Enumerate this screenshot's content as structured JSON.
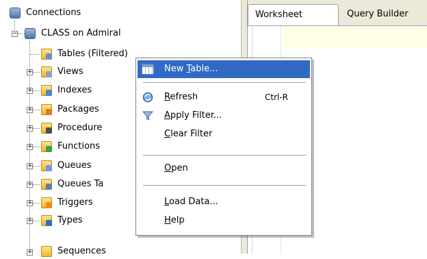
{
  "tree": {
    "root": {
      "label": "Connections",
      "icon": "connections-icon"
    },
    "connection": {
      "label": "CLASS on Admiral",
      "icon": "database-connection-icon"
    },
    "items": [
      {
        "label": "Tables (Filtered)",
        "icon": "tables-folder-icon"
      },
      {
        "label": "Views",
        "icon": "views-folder-icon"
      },
      {
        "label": "Indexes",
        "icon": "indexes-folder-icon"
      },
      {
        "label": "Packages",
        "icon": "packages-folder-icon"
      },
      {
        "label": "Procedure",
        "icon": "procedures-folder-icon"
      },
      {
        "label": "Functions",
        "icon": "functions-folder-icon"
      },
      {
        "label": "Queues",
        "icon": "queues-folder-icon"
      },
      {
        "label": "Queues Ta",
        "icon": "queue-tables-folder-icon"
      },
      {
        "label": "Triggers",
        "icon": "triggers-folder-icon"
      },
      {
        "label": "Types",
        "icon": "types-folder-icon"
      },
      {
        "label": "Sequences",
        "icon": "sequences-folder-icon"
      }
    ]
  },
  "tabs": [
    {
      "label": "Worksheet"
    },
    {
      "label": "Query Builder"
    }
  ],
  "context_menu": {
    "items": [
      {
        "pre": "New ",
        "key": "T",
        "post": "able...",
        "shortcut": "",
        "icon": "new-table-icon"
      },
      {
        "pre": "",
        "key": "R",
        "post": "efresh",
        "shortcut": "Ctrl-R",
        "icon": "refresh-icon"
      },
      {
        "pre": "",
        "key": "A",
        "post": "pply Filter...",
        "shortcut": "",
        "icon": "filter-icon"
      },
      {
        "pre": "",
        "key": "C",
        "post": "lear Filter",
        "shortcut": "",
        "icon": ""
      },
      {
        "pre": "",
        "key": "O",
        "post": "pen",
        "shortcut": "",
        "icon": ""
      },
      {
        "pre": "",
        "key": "L",
        "post": "oad Data...",
        "shortcut": "",
        "icon": ""
      },
      {
        "pre": "",
        "key": "H",
        "post": "elp",
        "shortcut": "",
        "icon": ""
      }
    ]
  },
  "colors": {
    "menu_highlight": "#316ac5",
    "editor_current_line": "#ffffe6",
    "chrome": "#ece9d8"
  }
}
